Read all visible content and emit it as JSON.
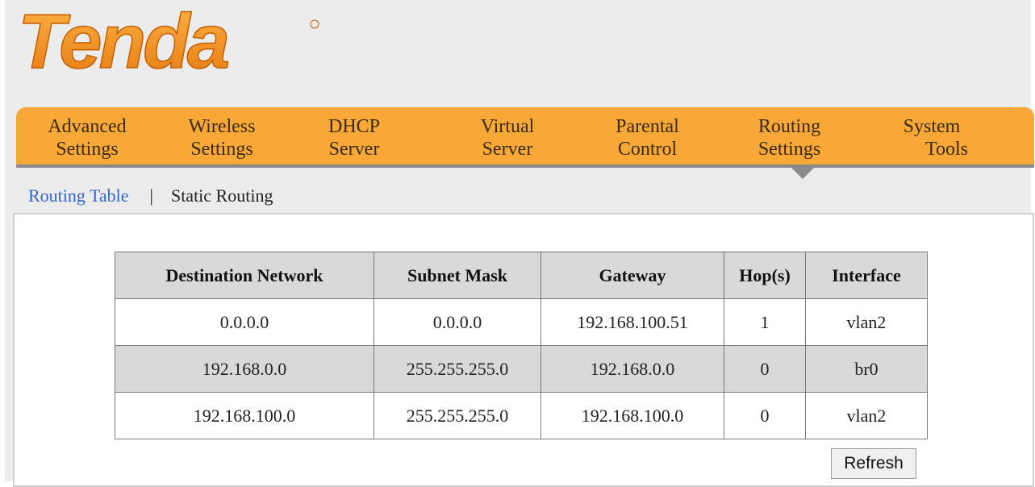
{
  "brand": {
    "logo_text": "Tenda",
    "color": "#f7941d"
  },
  "nav": {
    "items": [
      {
        "line1": "Advanced",
        "line2": "Settings"
      },
      {
        "line1": "Wireless",
        "line2": "Settings"
      },
      {
        "line1": "DHCP",
        "line2": "Server"
      },
      {
        "line1": "Virtual",
        "line2": "Server"
      },
      {
        "line1": "Parental",
        "line2": "Control"
      },
      {
        "line1": "Routing",
        "line2": "Settings"
      },
      {
        "line1": "System",
        "line2": "Tools"
      }
    ],
    "active_index": 5,
    "bar_color": "#f7a836"
  },
  "subnav": {
    "routing_table": "Routing Table",
    "separator": "|",
    "static_routing": "Static Routing"
  },
  "table": {
    "headers": [
      "Destination Network",
      "Subnet Mask",
      "Gateway",
      "Hop(s)",
      "Interface"
    ],
    "rows": [
      [
        "0.0.0.0",
        "0.0.0.0",
        "192.168.100.51",
        "1",
        "vlan2"
      ],
      [
        "192.168.0.0",
        "255.255.255.0",
        "192.168.0.0",
        "0",
        "br0"
      ],
      [
        "192.168.100.0",
        "255.255.255.0",
        "192.168.100.0",
        "0",
        "vlan2"
      ]
    ]
  },
  "refresh_label": "Refresh"
}
